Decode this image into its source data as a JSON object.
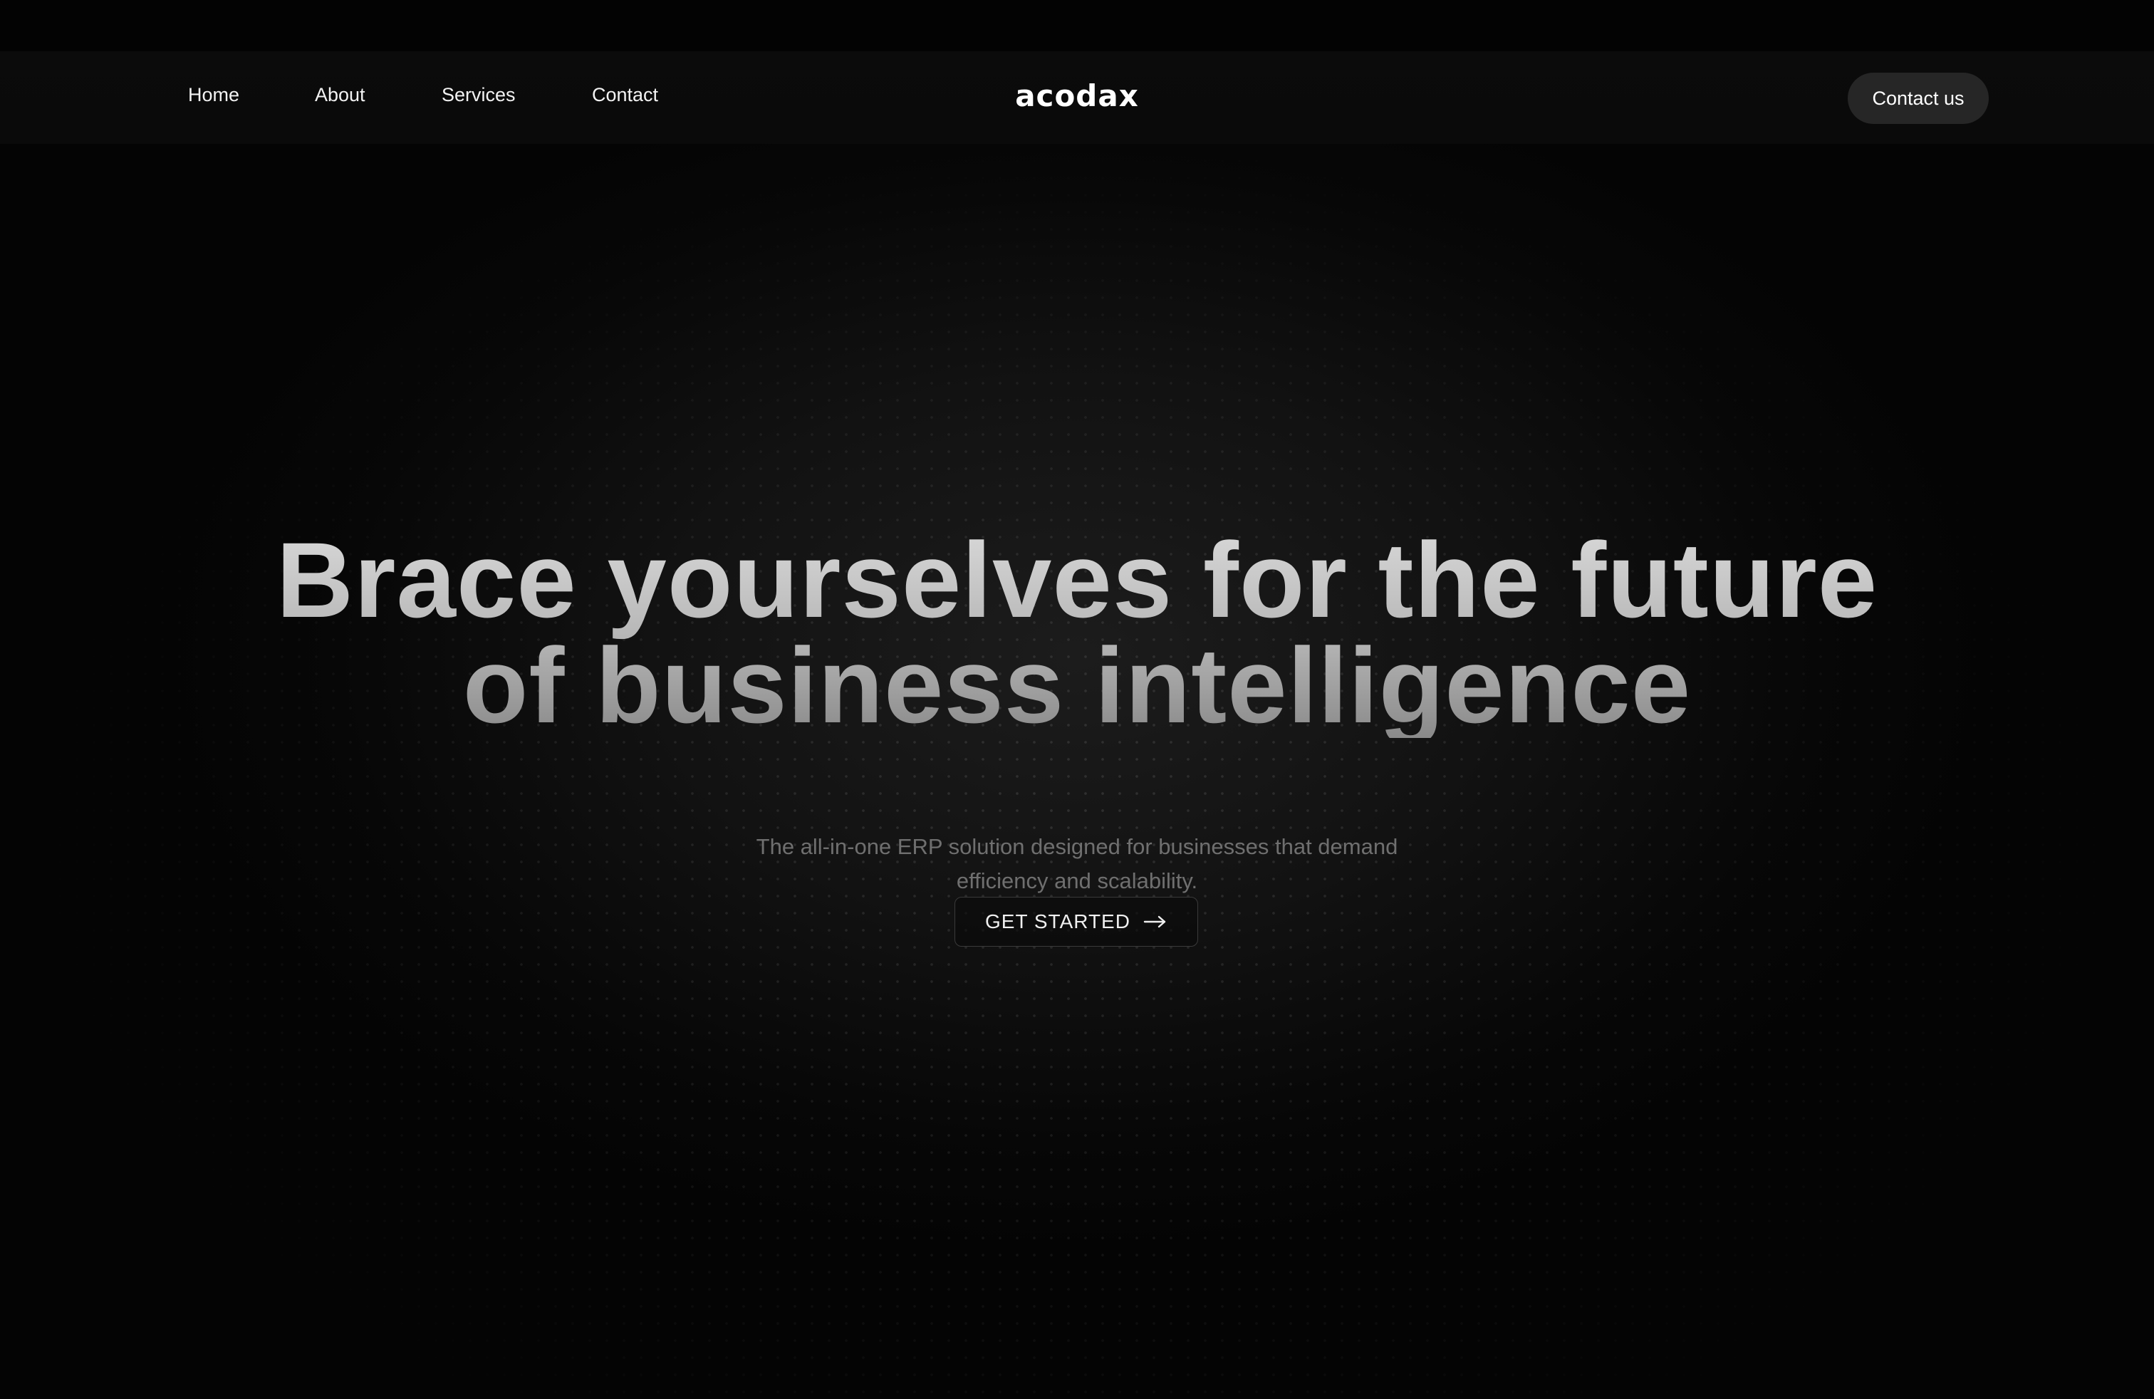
{
  "nav": {
    "links": [
      "Home",
      "About",
      "Services",
      "Contact"
    ],
    "logo": "acodax",
    "contact_button": "Contact us"
  },
  "hero": {
    "title_line1": "Brace yourselves for the future",
    "title_line2": "of business intelligence",
    "subtitle_line1": "The all-in-one ERP solution designed for businesses that demand",
    "subtitle_line2": "efficiency and scalability.",
    "cta_label": "GET STARTED",
    "cta_icon": "arrow-right-icon"
  },
  "colors": {
    "background": "#050505",
    "button_bg": "#262626",
    "subtitle": "#6f6f6f"
  }
}
